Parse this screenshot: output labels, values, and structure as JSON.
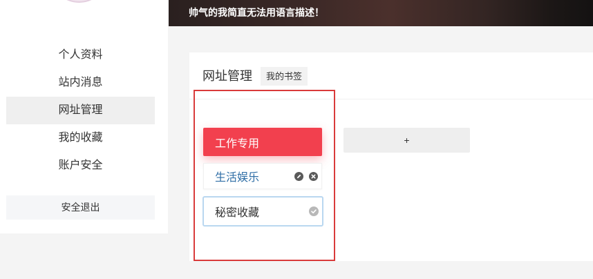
{
  "banner": {
    "text": "帅气的我简直无法用语言描述！"
  },
  "sidebar": {
    "items": [
      {
        "label": "个人资料",
        "selected": false
      },
      {
        "label": "站内消息",
        "selected": false
      },
      {
        "label": "网址管理",
        "selected": true
      },
      {
        "label": "我的收藏",
        "selected": false
      },
      {
        "label": "账户安全",
        "selected": false
      }
    ],
    "logout_label": "安全退出"
  },
  "main": {
    "title": "网址管理",
    "tab_label": "我的书签",
    "groups": [
      {
        "label": "工作专用",
        "selected": true
      },
      {
        "label": "生活娱乐",
        "icons": [
          "pencil-icon",
          "close-icon"
        ]
      },
      {
        "label": "秘密收藏",
        "editing": true,
        "icons": [
          "check-circle-icon"
        ]
      }
    ],
    "add_label": "+"
  },
  "colors": {
    "accent": "#f2404e",
    "link": "#2f6ea6",
    "edit_border": "#b9d7f0",
    "highlight": "#d93a3a"
  }
}
